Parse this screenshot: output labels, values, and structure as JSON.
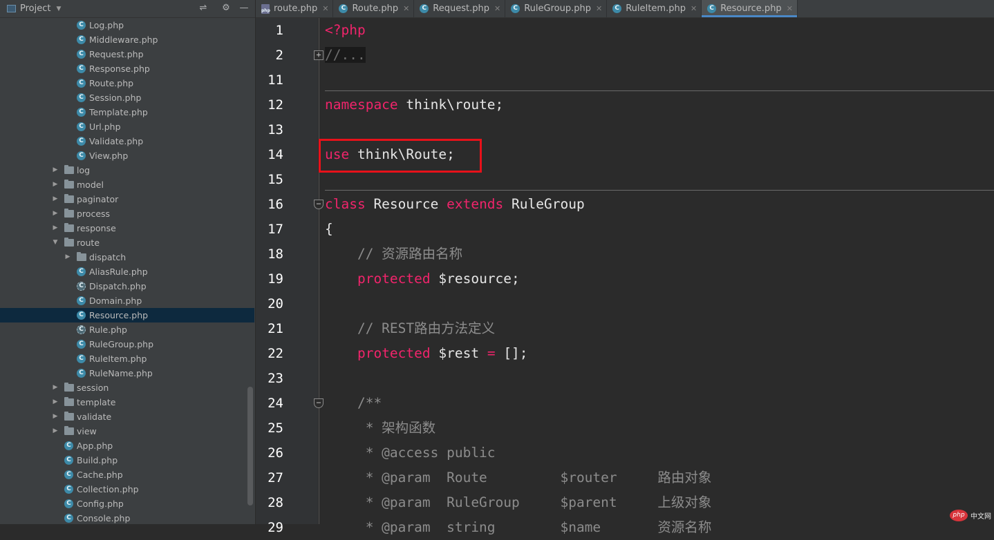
{
  "sidebar": {
    "title": "Project",
    "items": [
      {
        "label": "Log.php",
        "type": "class"
      },
      {
        "label": "Middleware.php",
        "type": "class"
      },
      {
        "label": "Request.php",
        "type": "class"
      },
      {
        "label": "Response.php",
        "type": "class"
      },
      {
        "label": "Route.php",
        "type": "class"
      },
      {
        "label": "Session.php",
        "type": "class"
      },
      {
        "label": "Template.php",
        "type": "class"
      },
      {
        "label": "Url.php",
        "type": "class"
      },
      {
        "label": "Validate.php",
        "type": "class"
      },
      {
        "label": "View.php",
        "type": "class"
      },
      {
        "label": "log",
        "type": "folder",
        "expanded": false
      },
      {
        "label": "model",
        "type": "folder",
        "expanded": false
      },
      {
        "label": "paginator",
        "type": "folder",
        "expanded": false
      },
      {
        "label": "process",
        "type": "folder",
        "expanded": false
      },
      {
        "label": "response",
        "type": "folder",
        "expanded": false
      },
      {
        "label": "route",
        "type": "folder",
        "expanded": true
      },
      {
        "label": "dispatch",
        "type": "folder",
        "expanded": false
      },
      {
        "label": "AliasRule.php",
        "type": "class"
      },
      {
        "label": "Dispatch.php",
        "type": "abstract-class"
      },
      {
        "label": "Domain.php",
        "type": "class"
      },
      {
        "label": "Resource.php",
        "type": "class",
        "selected": true
      },
      {
        "label": "Rule.php",
        "type": "abstract-class"
      },
      {
        "label": "RuleGroup.php",
        "type": "class"
      },
      {
        "label": "RuleItem.php",
        "type": "class"
      },
      {
        "label": "RuleName.php",
        "type": "class"
      },
      {
        "label": "session",
        "type": "folder",
        "expanded": false
      },
      {
        "label": "template",
        "type": "folder",
        "expanded": false
      },
      {
        "label": "validate",
        "type": "folder",
        "expanded": false
      },
      {
        "label": "view",
        "type": "folder",
        "expanded": false
      },
      {
        "label": "App.php",
        "type": "class"
      },
      {
        "label": "Build.php",
        "type": "class"
      },
      {
        "label": "Cache.php",
        "type": "class"
      },
      {
        "label": "Collection.php",
        "type": "class"
      },
      {
        "label": "Config.php",
        "type": "class"
      },
      {
        "label": "Console.php",
        "type": "class"
      }
    ]
  },
  "tabs": [
    {
      "label": "route.php",
      "icon": "php-file-icon"
    },
    {
      "label": "Route.php",
      "icon": "class-icon"
    },
    {
      "label": "Request.php",
      "icon": "class-icon"
    },
    {
      "label": "RuleGroup.php",
      "icon": "class-icon"
    },
    {
      "label": "RuleItem.php",
      "icon": "class-icon"
    },
    {
      "label": "Resource.php",
      "icon": "class-icon",
      "active": true
    }
  ],
  "editor": {
    "lines": [
      {
        "num": "1",
        "tokens": [
          {
            "t": "<?php",
            "c": "kw"
          }
        ]
      },
      {
        "num": "2",
        "tokens": [
          {
            "t": "//...",
            "c": "fcollapsed"
          }
        ]
      },
      {
        "num": "11",
        "tokens": []
      },
      {
        "num": "12",
        "tokens": [
          {
            "t": "namespace",
            "c": "kw"
          },
          {
            "t": " think\\route;",
            "c": ""
          }
        ]
      },
      {
        "num": "13",
        "tokens": []
      },
      {
        "num": "14",
        "tokens": [
          {
            "t": "use",
            "c": "kw"
          },
          {
            "t": " think\\Route;",
            "c": ""
          }
        ]
      },
      {
        "num": "15",
        "tokens": []
      },
      {
        "num": "16",
        "tokens": [
          {
            "t": "class",
            "c": "kw"
          },
          {
            "t": " Resource ",
            "c": ""
          },
          {
            "t": "extends",
            "c": "kw"
          },
          {
            "t": " RuleGroup",
            "c": ""
          }
        ]
      },
      {
        "num": "17",
        "tokens": [
          {
            "t": "{",
            "c": ""
          }
        ]
      },
      {
        "num": "18",
        "tokens": [
          {
            "t": "    // 资源路由名称",
            "c": "cm"
          }
        ]
      },
      {
        "num": "19",
        "tokens": [
          {
            "t": "    ",
            "c": ""
          },
          {
            "t": "protected",
            "c": "kw"
          },
          {
            "t": " $resource;",
            "c": ""
          }
        ]
      },
      {
        "num": "20",
        "tokens": []
      },
      {
        "num": "21",
        "tokens": [
          {
            "t": "    // REST路由方法定义",
            "c": "cm"
          }
        ]
      },
      {
        "num": "22",
        "tokens": [
          {
            "t": "    ",
            "c": ""
          },
          {
            "t": "protected",
            "c": "kw"
          },
          {
            "t": " $rest ",
            "c": ""
          },
          {
            "t": "=",
            "c": "kw"
          },
          {
            "t": " [];",
            "c": ""
          }
        ]
      },
      {
        "num": "23",
        "tokens": []
      },
      {
        "num": "24",
        "tokens": [
          {
            "t": "    /**",
            "c": "cm"
          }
        ]
      },
      {
        "num": "25",
        "tokens": [
          {
            "t": "     * 架构函数",
            "c": "cm"
          }
        ]
      },
      {
        "num": "26",
        "tokens": [
          {
            "t": "     * @access public",
            "c": "cm"
          }
        ]
      },
      {
        "num": "27",
        "tokens": [
          {
            "t": "     * @param  Route         $router     路由对象",
            "c": "cm"
          }
        ]
      },
      {
        "num": "28",
        "tokens": [
          {
            "t": "     * @param  RuleGroup     $parent     上级对象",
            "c": "cm"
          }
        ]
      },
      {
        "num": "29",
        "tokens": [
          {
            "t": "     * @param  string        $name       资源名称",
            "c": "cm"
          }
        ]
      }
    ]
  },
  "watermark": {
    "logo": "php",
    "text": "中文网"
  }
}
